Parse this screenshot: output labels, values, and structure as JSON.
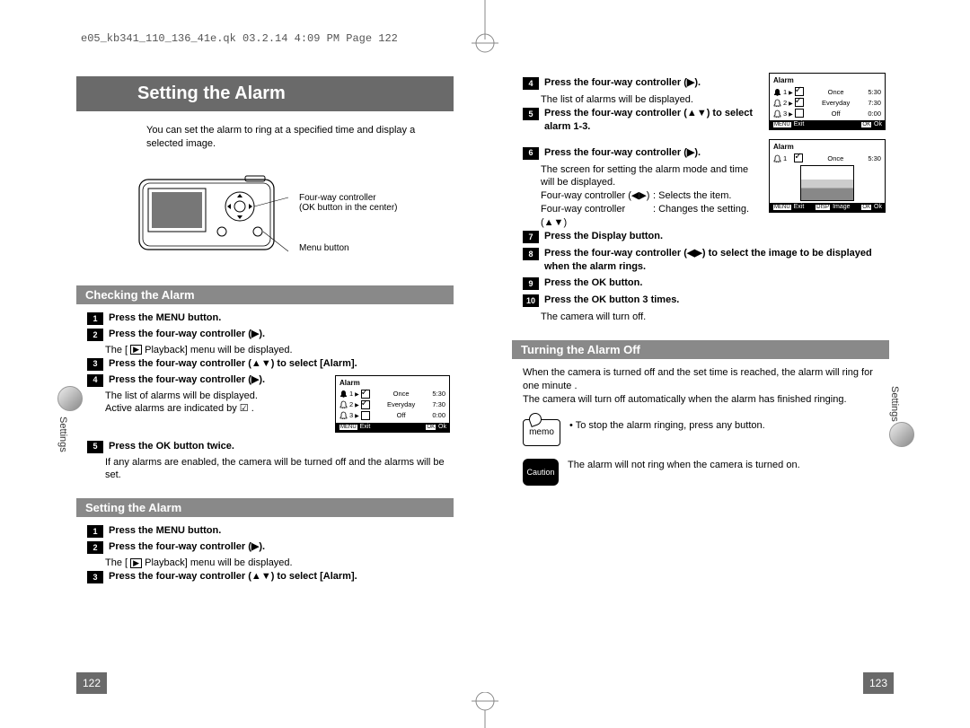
{
  "header": "e05_kb341_110_136_41e.qk  03.2.14  4:09 PM  Page 122",
  "page_left_num": "122",
  "page_right_num": "123",
  "sidebar_label": "Settings",
  "title": "Setting the Alarm",
  "intro": "You can set the alarm to ring at a specified time and display a selected image.",
  "camera": {
    "label1": "Four-way controller",
    "label1b": "(OK button in the center)",
    "label2": "Menu button"
  },
  "section_checking": "Checking the Alarm",
  "checking": {
    "s1": "Press the MENU button.",
    "s2": "Press the four-way controller (▶).",
    "s2sub_a": "The [",
    "s2sub_b": " Playback] menu will be displayed.",
    "s3": "Press the four-way controller (▲▼) to select [Alarm].",
    "s4": "Press the four-way controller (▶).",
    "s4sub1": "The list of alarms will be displayed.",
    "s4sub2": "Active alarms are indicated by ☑ .",
    "s5": "Press the OK button twice.",
    "s5sub": "If any alarms are enabled, the camera will be turned off and the alarms will be set."
  },
  "lcd1": {
    "title": "Alarm",
    "r1_num": "1",
    "r1_mode": "Once",
    "r1_time": "5:30",
    "r2_num": "2",
    "r2_mode": "Everyday",
    "r2_time": "7:30",
    "r3_num": "3",
    "r3_mode": "Off",
    "r3_time": "0:00",
    "exit": "Exit",
    "ok": "Ok",
    "menu": "MENU",
    "okbtn": "OK"
  },
  "section_setting": "Setting the Alarm",
  "setting": {
    "s1": "Press the MENU button.",
    "s2": "Press the four-way controller (▶).",
    "s2sub_a": "The [",
    "s2sub_b": " Playback] menu will be displayed.",
    "s3": "Press the four-way controller (▲▼) to select [Alarm]."
  },
  "right": {
    "s4": "Press the four-way controller (▶).",
    "s4sub": "The list of alarms will be displayed.",
    "s5": "Press the four-way controller (▲▼) to select alarm 1-3.",
    "s6": "Press the four-way controller (▶).",
    "s6sub": "The screen for setting the alarm mode and time will be displayed.",
    "s6a_l": "Four-way controller (◀▶)",
    "s6a_r": ": Selects the item.",
    "s6b_l": "Four-way controller (▲▼)",
    "s6b_r": ": Changes the setting.",
    "s7": "Press the Display button.",
    "s8": "Press the four-way controller (◀▶) to select the image to be displayed when the alarm rings.",
    "s9": "Press the OK button.",
    "s10": "Press the OK button 3 times.",
    "s10sub": "The camera will turn off."
  },
  "lcd2": {
    "title": "Alarm",
    "r1_num": "1",
    "r1_mode": "Once",
    "r1_time": "5:30",
    "exit": "Exit",
    "image": "Image",
    "ok": "Ok",
    "menu": "MENU",
    "disp": "DISP",
    "okbtn": "OK"
  },
  "section_off": "Turning the Alarm Off",
  "off": {
    "p1": "When the camera is turned off and the set time is reached, the alarm will ring for one minute .",
    "p2": "The camera will turn off automatically when the alarm has finished ringing.",
    "bullet": "To stop the alarm ringing, press any button.",
    "caution": "The alarm will not ring when the camera is turned on."
  },
  "memo_label": "memo",
  "caution_label": "Caution"
}
